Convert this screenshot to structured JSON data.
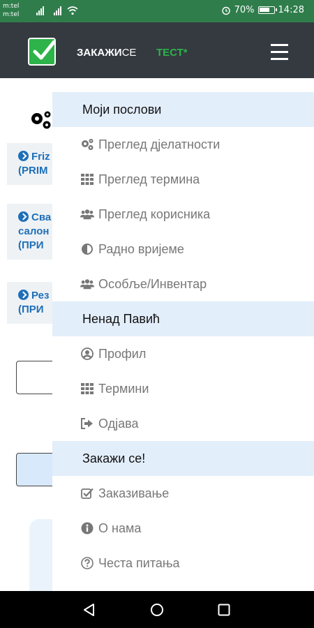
{
  "status_bar": {
    "carrier_1": "m:tel",
    "carrier_2": "m:tel",
    "battery_percent": "70%",
    "time": "14:28"
  },
  "header": {
    "brand_main": "ЗАКАЖИ",
    "brand_se": "СЕ",
    "test_label": "ТЕСТ*"
  },
  "background": {
    "cards": [
      {
        "line1": "Friz",
        "line2": "(PRIM"
      },
      {
        "line1": "Сва",
        "line2": "салон",
        "line3": "(ПРИ"
      },
      {
        "line1": "Рез",
        "line2": "(ПРИ"
      }
    ]
  },
  "menu": {
    "section_1": "Моји послови",
    "item_activities": "Преглед дјелатности",
    "item_terms_overview": "Преглед термина",
    "item_users_overview": "Преглед корисника",
    "item_working_hours": "Радно вријеме",
    "item_staff_inventory": "Особље/Инвентар",
    "section_2": "Ненад Павић",
    "item_profile": "Профил",
    "item_terms": "Термини",
    "item_logout": "Одјава",
    "section_3": "Закажи се!",
    "item_booking": "Заказивање",
    "item_about": "О нама",
    "item_faq": "Честа питања"
  },
  "colors": {
    "status_bar": "#2f7d4b",
    "header": "#343a40",
    "brand_green": "#2db34a",
    "section_bg": "#e3eefb",
    "link_blue": "#1e6fb8"
  }
}
